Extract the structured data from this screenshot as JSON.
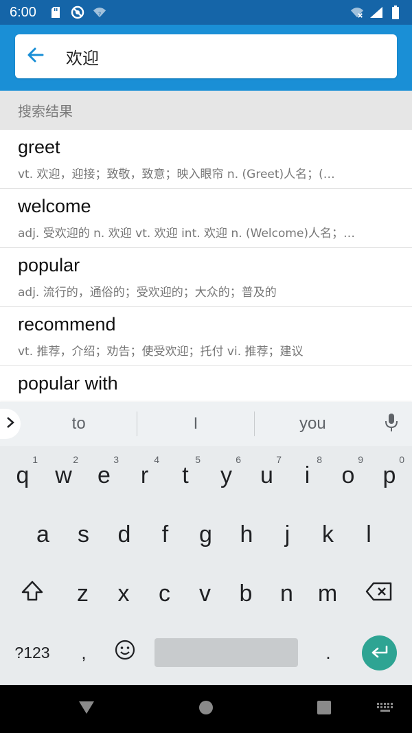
{
  "status_bar": {
    "time": "6:00",
    "left_icons": [
      "sd-card-icon",
      "do-not-disturb-icon",
      "wifi-unknown-icon"
    ],
    "right_icons": [
      "wifi-off-icon",
      "signal-icon",
      "battery-icon"
    ]
  },
  "search": {
    "value": "欢迎",
    "back_icon": "arrow-left-icon",
    "accent_color": "#1a8fd6"
  },
  "section_header": "搜索结果",
  "results": [
    {
      "word": "greet",
      "definition": "vt. 欢迎，迎接；致敬，致意；映入眼帘 n. (Greet)人名；(…"
    },
    {
      "word": "welcome",
      "definition": "adj. 受欢迎的 n. 欢迎 vt. 欢迎 int. 欢迎 n. (Welcome)人名；…"
    },
    {
      "word": "popular",
      "definition": "adj. 流行的，通俗的；受欢迎的；大众的；普及的"
    },
    {
      "word": "recommend",
      "definition": "vt. 推荐，介绍；劝告；使受欢迎；托付 vi. 推荐；建议"
    },
    {
      "word": "popular with",
      "definition": ""
    }
  ],
  "keyboard": {
    "suggestions": [
      "to",
      "I",
      "you"
    ],
    "row1": [
      {
        "k": "q",
        "h": "1"
      },
      {
        "k": "w",
        "h": "2"
      },
      {
        "k": "e",
        "h": "3"
      },
      {
        "k": "r",
        "h": "4"
      },
      {
        "k": "t",
        "h": "5"
      },
      {
        "k": "y",
        "h": "6"
      },
      {
        "k": "u",
        "h": "7"
      },
      {
        "k": "i",
        "h": "8"
      },
      {
        "k": "o",
        "h": "9"
      },
      {
        "k": "p",
        "h": "0"
      }
    ],
    "row2": [
      "a",
      "s",
      "d",
      "f",
      "g",
      "h",
      "j",
      "k",
      "l"
    ],
    "row3": [
      "z",
      "x",
      "c",
      "v",
      "b",
      "n",
      "m"
    ],
    "symbols_label": "?123",
    "comma": ",",
    "period": ".",
    "enter_color": "#2ea493"
  }
}
